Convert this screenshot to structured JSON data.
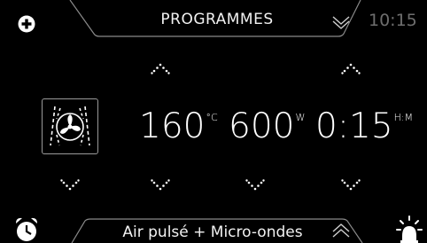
{
  "header": {
    "title": "PROGRAMMES",
    "time": "10:15"
  },
  "settings": {
    "temperature": {
      "value": "160",
      "unit": "°C"
    },
    "power": {
      "value": "600",
      "unit": "W"
    },
    "duration": {
      "value": "0:15",
      "unit": "H:M"
    }
  },
  "footer": {
    "mode_label": "Air pulsé + Micro-ondes"
  },
  "icons": {
    "add": "plus-circle-icon",
    "program_dropdown": "chevron-down-icon",
    "mode_expand": "chevron-up-icon",
    "alarm": "alarm-clock-icon",
    "light": "oven-light-icon",
    "fan_mode": "fan-convection-icon"
  },
  "colors": {
    "background": "#000000",
    "text": "#ffffff",
    "clock": "#6e6e6e",
    "tab_border": "#8a8a8a"
  }
}
